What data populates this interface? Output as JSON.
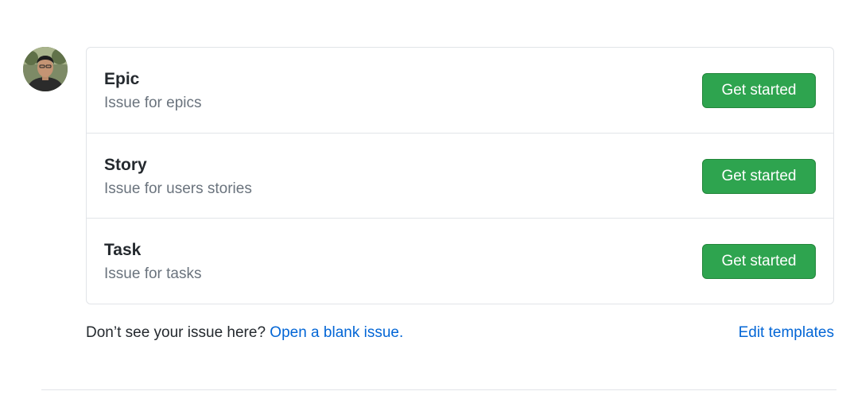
{
  "templates": [
    {
      "title": "Epic",
      "description": "Issue for epics",
      "button_label": "Get started"
    },
    {
      "title": "Story",
      "description": "Issue for users stories",
      "button_label": "Get started"
    },
    {
      "title": "Task",
      "description": "Issue for tasks",
      "button_label": "Get started"
    }
  ],
  "footer": {
    "prompt_text": "Don’t see your issue here?",
    "blank_issue_link": "Open a blank issue.",
    "edit_templates_link": "Edit templates"
  },
  "colors": {
    "button_green": "#2ea44f",
    "link_blue": "#0366d6",
    "muted_text": "#6a737d",
    "border": "#e1e4e8"
  }
}
